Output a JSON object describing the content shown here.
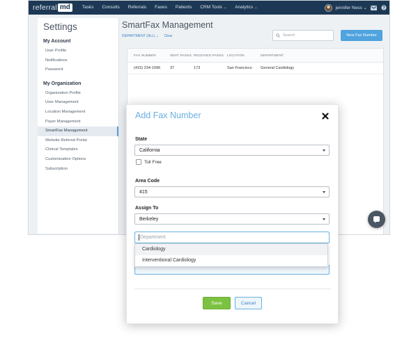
{
  "topbar": {
    "logo_left": "referral",
    "logo_right": "md",
    "nav": [
      {
        "label": "Tasks"
      },
      {
        "label": "Consults"
      },
      {
        "label": "Referrals"
      },
      {
        "label": "Faxes"
      },
      {
        "label": "Patients"
      },
      {
        "label": "CRM Tools",
        "caret": "⌄"
      },
      {
        "label": "Analytics",
        "caret": "⌄"
      }
    ],
    "user_name": "jennifer Ness",
    "user_caret": "⌄"
  },
  "sidebar": {
    "title": "Settings",
    "my_account": {
      "heading": "My Account",
      "items": [
        "User Profile",
        "Notifications",
        "Password"
      ]
    },
    "my_organization": {
      "heading": "My Organization",
      "items": [
        "Organization Profile",
        "User Management",
        "Location Management",
        "Payer Management",
        "SmartFax Management",
        "Website Referral Portal",
        "Clinical Templates",
        "Customization Options",
        "Subscription"
      ],
      "active_index": 4
    }
  },
  "main": {
    "title": "SmartFax Management",
    "filter_label": "DEPARTMENT (ALL) ⌄",
    "clear_label": "Clear",
    "search_placeholder": "Search",
    "new_button": "New Fax Number",
    "table": {
      "headers": [
        "FAX NUMBER",
        "SENT PAGES",
        "RECEIVED PAGES",
        "LOCATION",
        "DEPARTMENT"
      ],
      "rows": [
        [
          "(415) 234-1096",
          "37",
          "173",
          "San Francisco",
          "General Cardiology"
        ]
      ]
    }
  },
  "modal": {
    "title": "Add Fax Number",
    "state_label": "State",
    "state_value": "California",
    "toll_free_label": "Toll Free",
    "area_code_label": "Area Code",
    "area_code_value": "415",
    "assign_to_label": "Assign To",
    "assign_to_value": "Berkeley",
    "department_placeholder": "Department",
    "department_options": [
      "Cardiology",
      "Interventional Cardiology"
    ],
    "save_label": "Save",
    "cancel_label": "Cancel"
  },
  "colors": {
    "topbar": "#1c3854",
    "accent": "#4fa3de",
    "save": "#7cc242",
    "modal_title": "#6ab0e0"
  }
}
